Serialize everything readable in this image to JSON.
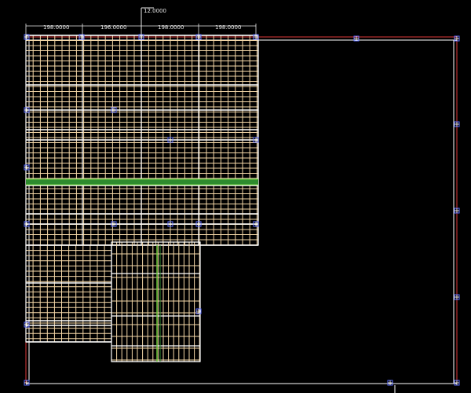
{
  "colors": {
    "background": "#000000",
    "grid_line": "#f5d8a8",
    "grid_line_alt": "#ffffff",
    "frame_red": "#e03a3a",
    "frame_white": "#ffffff",
    "highlight_green": "#2e8b2e",
    "highlight_green_bright": "#6ccf3a",
    "dimension": "#e8e8e8",
    "node_marker": "#5a6cff"
  },
  "dimensions": {
    "top_offset": "12.0000",
    "segments": [
      "198.0000",
      "196.0000",
      "198.0000",
      "198.0000"
    ]
  },
  "icons": {
    "node_marker": "node-marker-icon",
    "cursor": "crosshair-cursor-icon"
  }
}
